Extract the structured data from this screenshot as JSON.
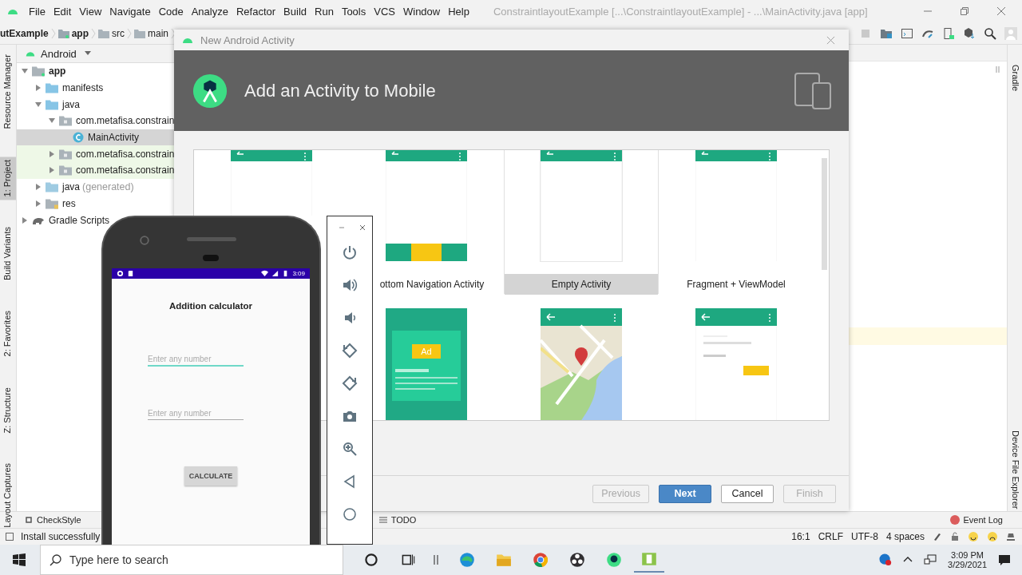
{
  "menu": [
    "File",
    "Edit",
    "View",
    "Navigate",
    "Code",
    "Analyze",
    "Refactor",
    "Build",
    "Run",
    "Tools",
    "VCS",
    "Window",
    "Help"
  ],
  "window_title": "ConstraintlayoutExample [...\\ConstraintlayoutExample] - ...\\MainActivity.java [app]",
  "breadcrumbs": [
    {
      "label": "utExample",
      "kind": "project"
    },
    {
      "label": "app",
      "kind": "module"
    },
    {
      "label": "src",
      "kind": "folder"
    },
    {
      "label": "main",
      "kind": "folder"
    }
  ],
  "left_tool_tabs": [
    {
      "label": "Resource Manager",
      "selected": false
    },
    {
      "label": "1: Project",
      "selected": true
    },
    {
      "label": "Build Variants",
      "selected": false
    },
    {
      "label": "2: Favorites",
      "selected": false
    },
    {
      "label": "Z: Structure",
      "selected": false
    },
    {
      "label": "Layout Captures",
      "selected": false
    }
  ],
  "right_tool_tabs": [
    "Gradle",
    "Device File Explorer"
  ],
  "project_view": "Android",
  "tree": [
    {
      "label": "app",
      "kind": "module",
      "expanded": true,
      "selected": false,
      "test": false,
      "children": [
        {
          "label": "manifests",
          "kind": "folder",
          "expanded": false,
          "selected": false,
          "test": false
        },
        {
          "label": "java",
          "kind": "folder",
          "expanded": true,
          "selected": false,
          "test": false,
          "children": [
            {
              "label": "com.metafisa.constrain",
              "kind": "package",
              "expanded": true,
              "selected": false,
              "test": false,
              "children": [
                {
                  "label": "MainActivity",
                  "kind": "class",
                  "selected": true,
                  "test": false
                }
              ]
            },
            {
              "label": "com.metafisa.constrain",
              "kind": "package",
              "expanded": false,
              "selected": false,
              "test": true
            },
            {
              "label": "com.metafisa.constrain",
              "kind": "package",
              "expanded": false,
              "selected": false,
              "test": true
            }
          ]
        },
        {
          "label": "java",
          "note": "(generated)",
          "kind": "generated",
          "expanded": false,
          "selected": false,
          "test": false
        },
        {
          "label": "res",
          "kind": "res",
          "expanded": false,
          "selected": false,
          "test": false
        }
      ]
    },
    {
      "label": "Gradle Scripts",
      "kind": "gradle",
      "expanded": false,
      "selected": false,
      "test": false
    }
  ],
  "dialog": {
    "title": "New Android Activity",
    "heading": "Add an Activity to Mobile",
    "templates": [
      {
        "kind": "basic",
        "selected": false
      },
      {
        "kind": "bottomnav",
        "label": "ottom Navigation Activity",
        "selected": false
      },
      {
        "kind": "empty",
        "label": "Empty Activity",
        "selected": true
      },
      {
        "kind": "fragment",
        "label": "Fragment + ViewModel",
        "selected": false
      },
      {
        "kind": "ad",
        "badge": "Ad",
        "selected": false
      },
      {
        "kind": "map",
        "selected": false
      },
      {
        "kind": "login",
        "selected": false
      }
    ],
    "buttons": [
      {
        "label": "Previous",
        "kind": "default",
        "disabled": true
      },
      {
        "label": "Next",
        "kind": "primary",
        "disabled": false
      },
      {
        "label": "Cancel",
        "kind": "default",
        "disabled": false
      },
      {
        "label": "Finish",
        "kind": "default",
        "disabled": true
      }
    ]
  },
  "phone": {
    "time": "3:09",
    "title": "Addition calculator",
    "fields": [
      {
        "placeholder": "Enter any number",
        "focused": true
      },
      {
        "placeholder": "Enter any number",
        "focused": false
      }
    ],
    "button": "CALCULATE"
  },
  "bottom_tabs": [
    {
      "label": "CheckStyle",
      "kind": "checkstyle"
    },
    {
      "label": "TODO",
      "kind": "todo"
    }
  ],
  "event_log": "Event Log",
  "status_message": "Install successfully",
  "status_items": [
    "16:1",
    "CRLF",
    "UTF-8",
    "4 spaces"
  ],
  "taskbar": {
    "search_placeholder": "Type here to search",
    "time": "3:09 PM",
    "date": "3/29/2021"
  }
}
